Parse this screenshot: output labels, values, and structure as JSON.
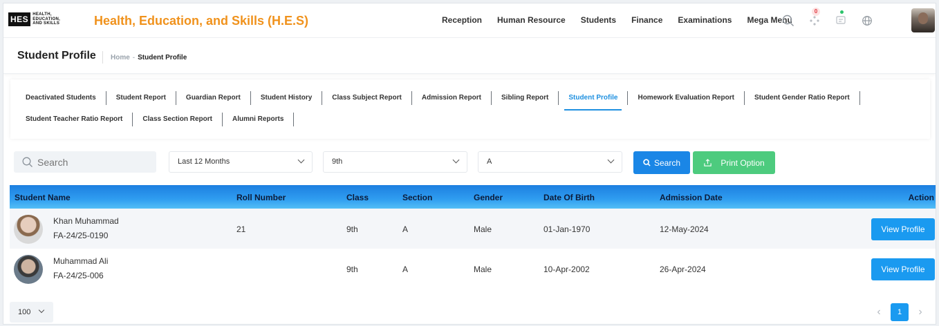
{
  "app": {
    "logo_mark": "HES",
    "logo_words": [
      "HEALTH,",
      "EDUCATION,",
      "AND SKILLS"
    ],
    "title": "Health, Education, and Skills (H.E.S)"
  },
  "topnav": [
    "Reception",
    "Human Resource",
    "Students",
    "Finance",
    "Examinations",
    "Mega Menu"
  ],
  "notifications": {
    "count": "0"
  },
  "page": {
    "title": "Student Profile",
    "breadcrumb_home": "Home",
    "breadcrumb_sep": "-",
    "breadcrumb_current": "Student Profile"
  },
  "tabs": {
    "row1": [
      "Deactivated Students",
      "Student Report",
      "Guardian Report",
      "Student History",
      "Class Subject Report",
      "Admission Report",
      "Sibling Report",
      "Student Profile",
      "Homework Evaluation Report",
      "Student Gender Ratio Report"
    ],
    "row2": [
      "Student Teacher Ratio Report",
      "Class Section Report",
      "Alumni Reports"
    ],
    "active": "Student Profile"
  },
  "filters": {
    "search_placeholder": "Search",
    "period": "Last 12 Months",
    "class": "9th",
    "section": "A",
    "search_button": "Search",
    "print_button": "Print Option"
  },
  "table": {
    "columns": [
      "Student Name",
      "Roll Number",
      "Class",
      "Section",
      "Gender",
      "Date Of Birth",
      "Admission Date",
      "Action"
    ],
    "rows": [
      {
        "name": "Khan Muhammad",
        "id": "FA-24/25-0190",
        "roll": "21",
        "class": "9th",
        "section": "A",
        "gender": "Male",
        "dob": "01-Jan-1970",
        "admission": "12-May-2024",
        "action": "View Profile"
      },
      {
        "name": "Muhammad Ali",
        "id": "FA-24/25-006",
        "roll": "",
        "class": "9th",
        "section": "A",
        "gender": "Male",
        "dob": "10-Apr-2002",
        "admission": "26-Apr-2024",
        "action": "View Profile"
      }
    ]
  },
  "footer": {
    "page_size": "100",
    "current_page": "1",
    "prev": "‹",
    "next": "›"
  },
  "colors": {
    "brand_title": "#f0921c",
    "primary": "#1a86e6",
    "success": "#4dcb7e",
    "header_gradient_start": "#1d7fe0"
  }
}
